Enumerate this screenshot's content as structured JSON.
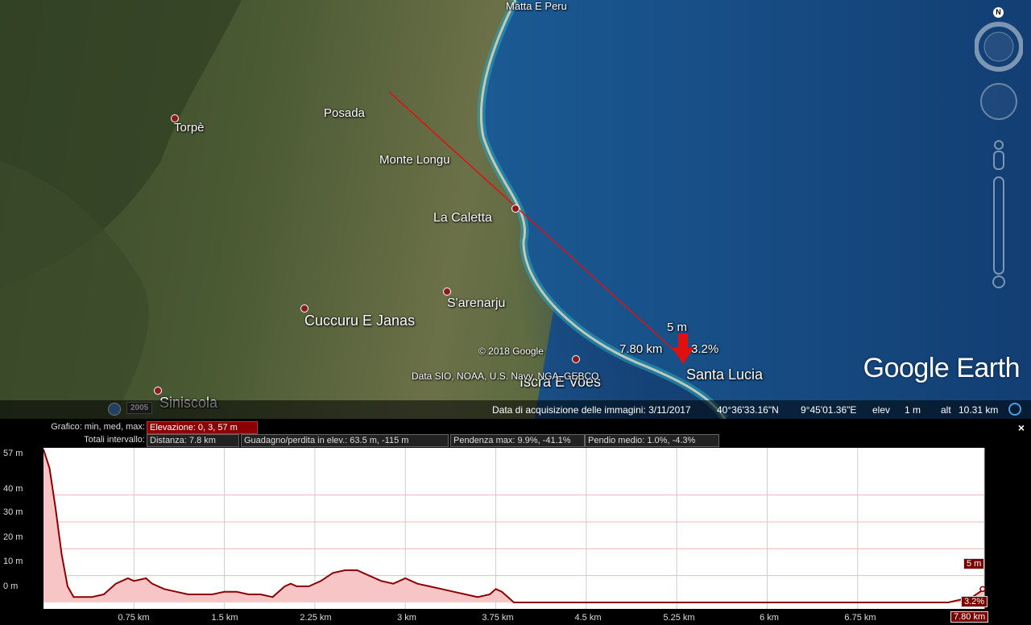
{
  "map": {
    "places": [
      {
        "name": "Matta E Peru"
      },
      {
        "name": "Torpè"
      },
      {
        "name": "Posada"
      },
      {
        "name": "Monte Longu"
      },
      {
        "name": "La Caletta"
      },
      {
        "name": "S'arenarju"
      },
      {
        "name": "Cuccuru E Janas"
      },
      {
        "name": "Santa Lucia"
      },
      {
        "name": "Iscra E Voes"
      },
      {
        "name": "Siniscola"
      }
    ],
    "marker": {
      "elev": "5 m",
      "dist": "7.80 km",
      "slope": "3.2%"
    },
    "copyright": "© 2018 Google",
    "data_credits": "Data SIO, NOAA, U.S. Navy, NGA, GEBCO",
    "logo": "Google Earth",
    "year_badge": "2005",
    "north_label": "N"
  },
  "statusbar": {
    "date": "Data di acquisizione delle immagini: 3/11/2017",
    "lat": "40°36'33.16\"N",
    "lon": "9°45'01.36\"E",
    "elev_label": "elev",
    "elev_value": "1 m",
    "alt_label": "alt",
    "alt_value": "10.31 km"
  },
  "profile": {
    "graph_label": "Grafico: min, med, max:",
    "elevation": "Elevazione: 0, 3, 57 m",
    "totals_label": "Totali intervallo:",
    "distance": "Distanza: 7.8 km",
    "gain_loss": "Guadagno/perdita in elev.: 63.5 m, -115 m",
    "max_slope": "Pendenza max: 9.9%, -41.1%",
    "avg_slope": "Pendio medio: 1.0%, -4.3%",
    "close": "×",
    "cursor_elev": "5 m",
    "cursor_slope": "3.2%",
    "cursor_dist": "7.80 km",
    "colors": {
      "fill": "#f7c5c5",
      "line": "#8b0000",
      "bg": "#ffffff"
    }
  },
  "chart_data": {
    "type": "area",
    "ylabels": [
      "57 m",
      "40 m",
      "30 m",
      "20 m",
      "10 m",
      "0 m"
    ],
    "xlabels": [
      "0.75 km",
      "1.5 km",
      "2.25 km",
      "3 km",
      "3.75 km",
      "4.5 km",
      "5.25 km",
      "6 km",
      "6.75 km",
      "7.80 km"
    ],
    "x": [
      0,
      0.05,
      0.1,
      0.15,
      0.2,
      0.25,
      0.3,
      0.4,
      0.5,
      0.6,
      0.7,
      0.75,
      0.85,
      0.9,
      1.0,
      1.1,
      1.2,
      1.3,
      1.4,
      1.5,
      1.6,
      1.7,
      1.8,
      1.9,
      2.0,
      2.05,
      2.1,
      2.2,
      2.3,
      2.4,
      2.5,
      2.6,
      2.65,
      2.7,
      2.8,
      2.9,
      3.0,
      3.1,
      3.2,
      3.3,
      3.4,
      3.5,
      3.6,
      3.7,
      3.75,
      3.8,
      3.85,
      3.9,
      4.0,
      4.5,
      5.0,
      5.5,
      6.0,
      6.5,
      7.0,
      7.5,
      7.7,
      7.8
    ],
    "y": [
      57,
      50,
      35,
      18,
      6,
      2,
      2,
      2,
      3,
      7,
      9,
      8,
      9,
      7,
      5,
      4,
      3,
      3,
      3,
      4,
      4,
      3,
      3,
      2,
      6,
      7,
      6,
      6,
      8,
      11,
      12,
      12,
      11,
      10,
      8,
      7,
      9,
      7,
      6,
      5,
      4,
      3,
      2,
      3,
      5,
      4,
      2,
      0,
      0,
      0,
      0,
      0,
      0,
      0,
      0,
      0,
      2,
      5
    ],
    "xlim": [
      0,
      7.8
    ],
    "ylim": [
      0,
      57
    ],
    "grid": true
  }
}
